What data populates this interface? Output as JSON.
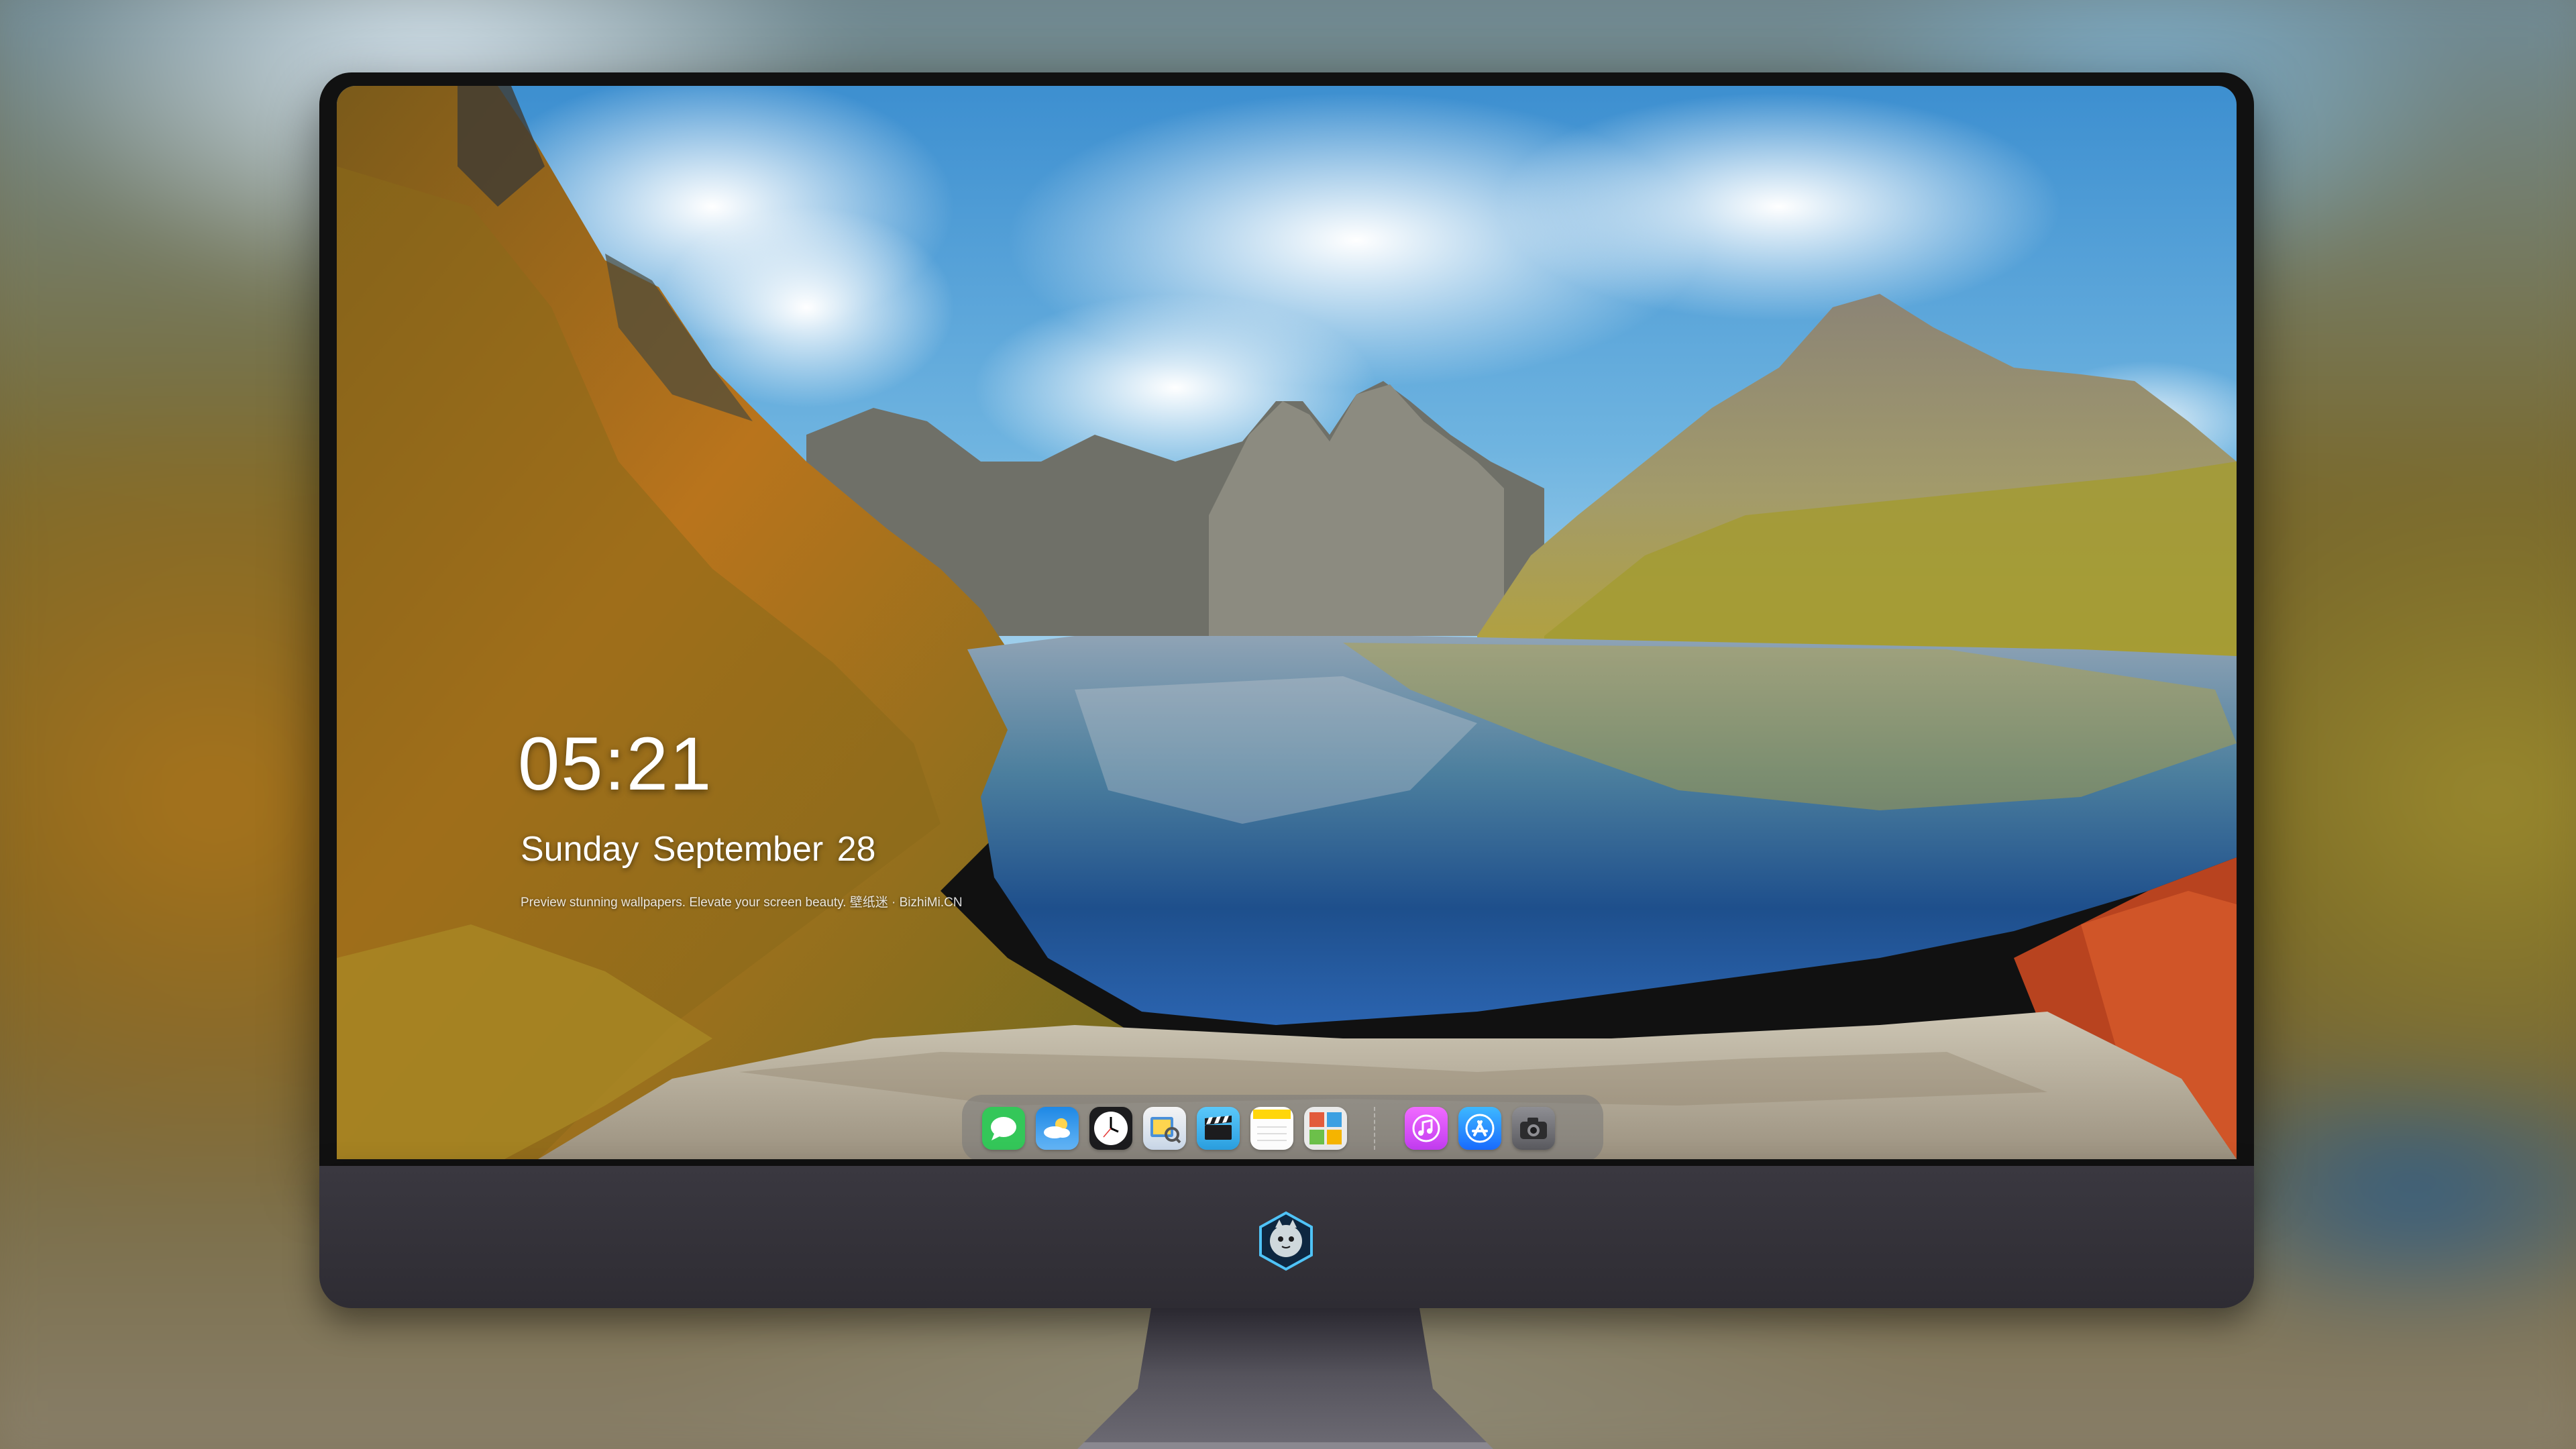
{
  "lock_screen": {
    "time": "05:21",
    "date": "Sunday September  28",
    "caption": "Preview stunning wallpapers. Elevate your screen beauty. 壁纸迷 · BizhiMi.CN"
  },
  "dock": {
    "apps": [
      {
        "name": "Messages",
        "icon": "messages-icon",
        "color": "#34c759"
      },
      {
        "name": "Weather",
        "icon": "weather-icon",
        "color": "#1e88e5"
      },
      {
        "name": "Clock",
        "icon": "clock-icon",
        "color": "#1c1c1e"
      },
      {
        "name": "Preview",
        "icon": "preview-icon",
        "color": "#4a90d9"
      },
      {
        "name": "Clips",
        "icon": "clapperboard-icon",
        "color": "#5ac8fa"
      },
      {
        "name": "Notes",
        "icon": "notes-icon",
        "color": "#ffd60a"
      },
      {
        "name": "Photo Booth",
        "icon": "photo-booth-icon",
        "color": "#e25b3c"
      },
      {
        "name": "Music",
        "icon": "music-icon",
        "color": "#e040fb"
      },
      {
        "name": "App Store",
        "icon": "app-store-icon",
        "color": "#1a8cff"
      },
      {
        "name": "Camera",
        "icon": "camera-icon",
        "color": "#6e6e73"
      }
    ]
  },
  "monitor": {
    "logo": "mascot-logo-icon"
  }
}
